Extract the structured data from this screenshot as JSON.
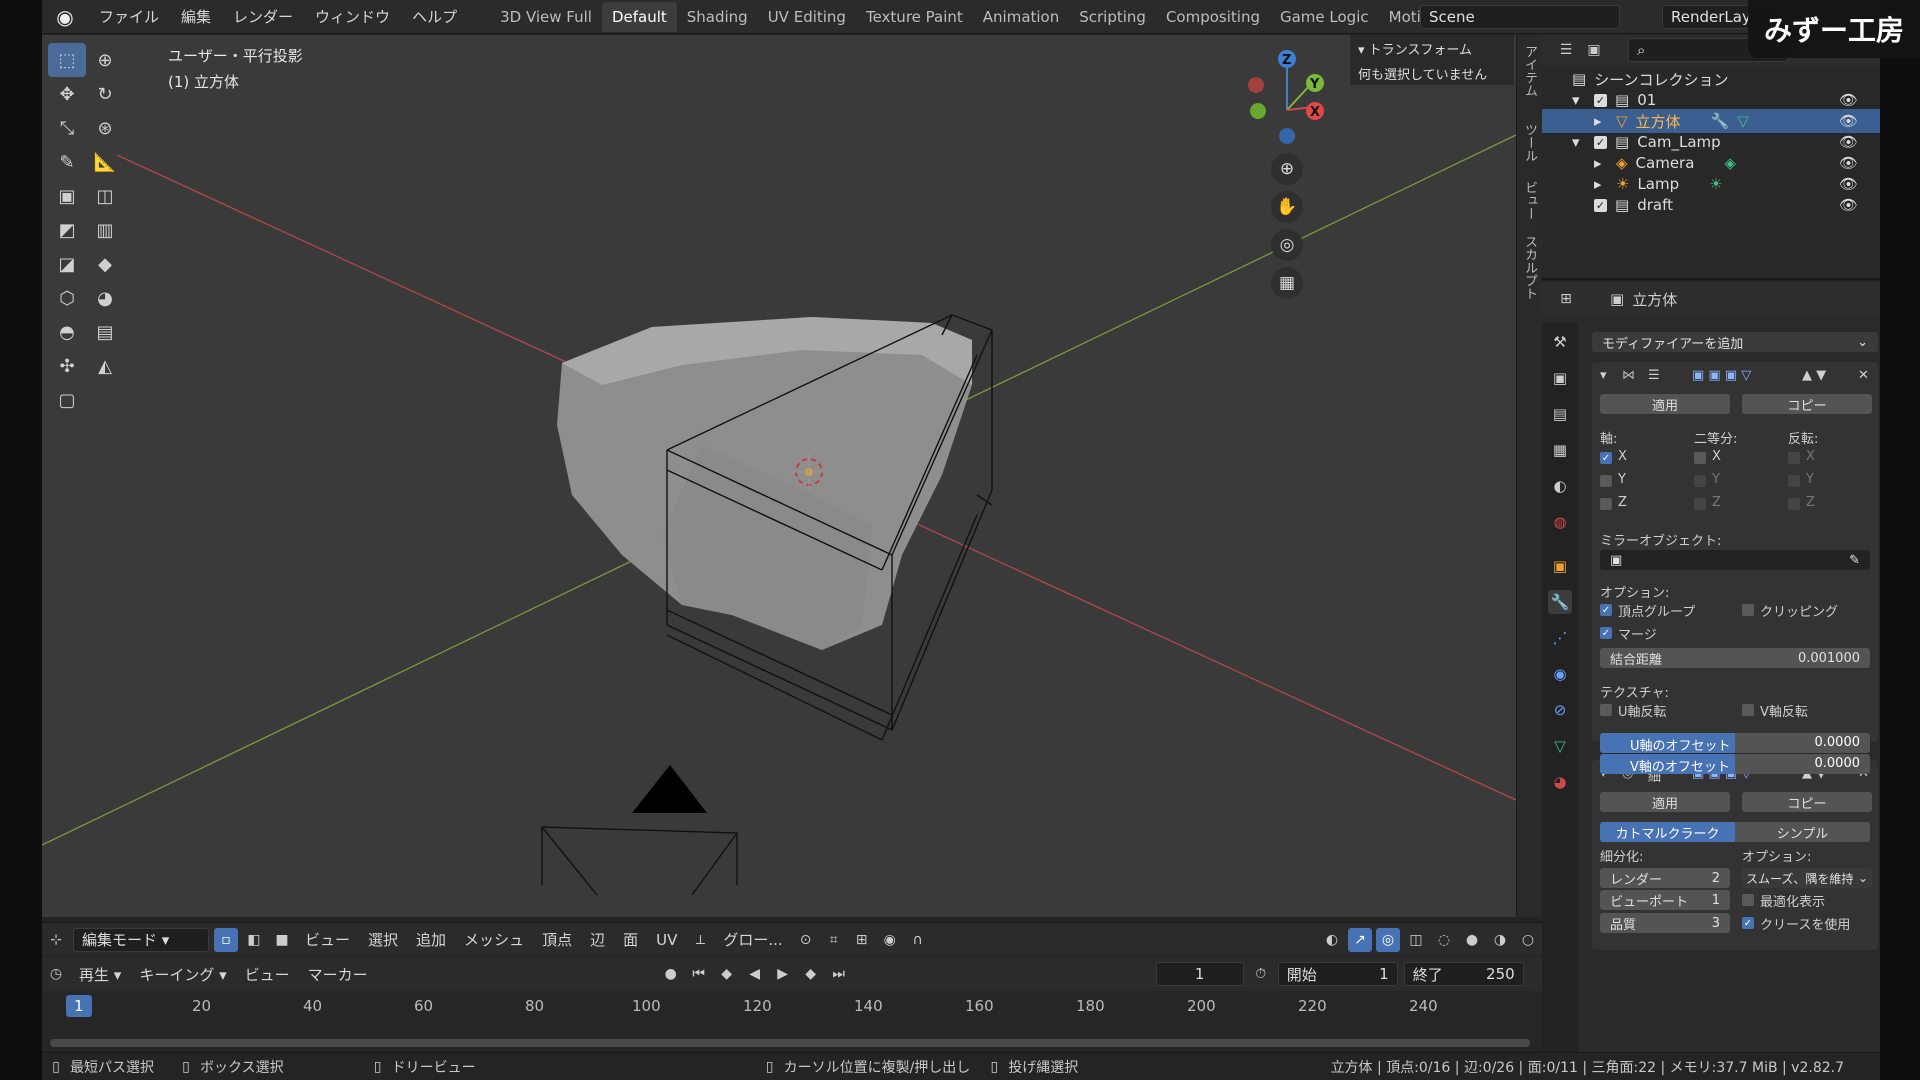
{
  "menu": [
    "ファイル",
    "編集",
    "レンダー",
    "ウィンドウ",
    "ヘルプ"
  ],
  "workspaces": [
    "3D View Full",
    "Default",
    "Shading",
    "UV Editing",
    "Texture Paint",
    "Animation",
    "Scripting",
    "Compositing",
    "Game Logic",
    "Motic"
  ],
  "active_workspace": "Default",
  "scene_name": "Scene",
  "render_layer": "RenderLay",
  "watermark": "みずー工房",
  "viewport": {
    "view_label": "ユーザー・平行投影",
    "object_label": "(1) 立方体",
    "transform_title": "トランスフォーム",
    "transform_msg": "何も選択していません",
    "side_tabs": [
      "アイテム",
      "ツール",
      "ビュー",
      "スカルプト"
    ]
  },
  "gizmo": {
    "x": "X",
    "y": "Y",
    "z": "Z"
  },
  "vp_header": {
    "mode": "編集モード",
    "menus": [
      "ビュー",
      "選択",
      "追加",
      "メッシュ",
      "頂点",
      "辺",
      "面",
      "UV"
    ],
    "orientation": "グロー..."
  },
  "timeline_header": {
    "menus": [
      "再生",
      "キーイング",
      "ビュー",
      "マーカー"
    ],
    "current_frame": "1",
    "start_label": "開始",
    "start": "1",
    "end_label": "終了",
    "end": "250"
  },
  "ruler": [
    "1",
    "20",
    "40",
    "60",
    "80",
    "100",
    "120",
    "140",
    "160",
    "180",
    "200",
    "220",
    "240"
  ],
  "status": {
    "items": [
      "最短パス選択",
      "ボックス選択",
      "ドリービュー",
      "カーソル位置に複製/押し出し",
      "投げ縄選択"
    ],
    "info": "立方体 | 頂点:0/16 | 辺:0/26 | 面:0/11 | 三角面:22 | メモリ:37.7 MiB | v2.82.7"
  },
  "outliner": {
    "root": "シーンコレクション",
    "rows": [
      {
        "label": "01",
        "checked": true
      },
      {
        "label": "立方体",
        "selected": true
      },
      {
        "label": "Cam_Lamp",
        "checked": true
      },
      {
        "label": "Camera"
      },
      {
        "label": "Lamp"
      },
      {
        "label": "draft",
        "checked": true
      }
    ]
  },
  "properties": {
    "object_name": "立方体",
    "add_modifier": "モディファイアーを追加",
    "mirror": {
      "apply": "適用",
      "copy": "コピー",
      "axis_label": "軸:",
      "bisect_label": "二等分:",
      "flip_label": "反転:",
      "axes": [
        "X",
        "Y",
        "Z"
      ],
      "mirror_object": "ミラーオブジェクト:",
      "options_label": "オプション:",
      "vertex_groups": "頂点グループ",
      "clipping": "クリッピング",
      "merge": "マージ",
      "merge_dist_label": "結合距離",
      "merge_dist": "0.001000",
      "texture_label": "テクスチャ:",
      "u_flip": "U軸反転",
      "v_flip": "V軸反転",
      "u_offset_label": "U軸のオフセット",
      "u_offset": "0.0000",
      "v_offset_label": "V軸のオフセット",
      "v_offset": "0.0000"
    },
    "subsurf": {
      "name": "細",
      "apply": "適用",
      "copy": "コピー",
      "catmull": "カトマルクラーク",
      "simple": "シンプル",
      "subdiv_label": "細分化:",
      "options_label": "オプション:",
      "render_label": "レンダー",
      "render_val": "2",
      "viewport_label": "ビューポート",
      "viewport_val": "1",
      "quality_label": "品質",
      "quality_val": "3",
      "smooth": "スムーズ、隅を維持",
      "optimal": "最適化表示",
      "crease": "クリースを使用"
    }
  }
}
